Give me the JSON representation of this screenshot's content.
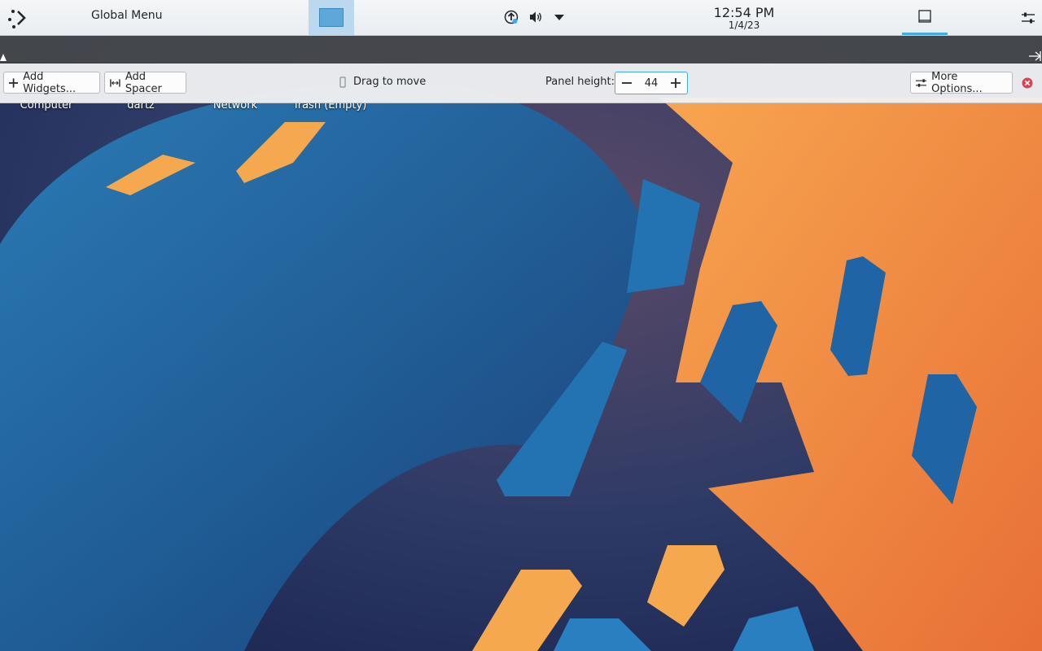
{
  "top_panel": {
    "global_menu_label": "Global Menu",
    "clock": {
      "time": "12:54 PM",
      "date": "1/4/23"
    }
  },
  "desktop_icons": [
    {
      "label": "Computer"
    },
    {
      "label": "dartz"
    },
    {
      "label": "Network"
    },
    {
      "label": "Trash (Empty)"
    }
  ],
  "edit_toolbar": {
    "add_widgets_label": "Add Widgets...",
    "add_spacer_label": "Add Spacer",
    "drag_label": "Drag to move",
    "panel_height_label": "Panel height:",
    "panel_height_value": "44",
    "more_options_label": "More Options..."
  },
  "colors": {
    "accent": "#3daee9",
    "close": "#da4453",
    "pager_active": "#5ea7d9"
  },
  "icons": [
    "launcher-icon",
    "desktop-pager-icon",
    "updates-icon",
    "volume-icon",
    "tray-expand-icon",
    "show-desktop-icon",
    "panel-config-icon",
    "plus-icon",
    "spacer-icon",
    "drag-handle-icon",
    "minus-icon",
    "settings-sliders-icon",
    "close-icon"
  ]
}
